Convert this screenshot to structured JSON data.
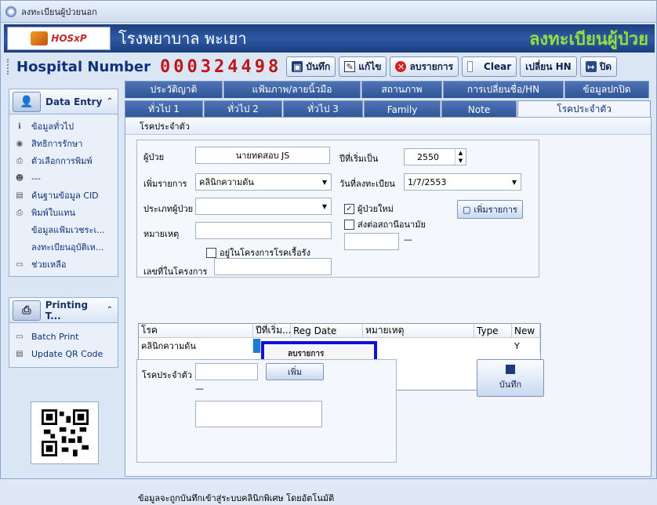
{
  "window": {
    "title": "ลงทะเบียนผู้ป่วยนอก"
  },
  "header": {
    "logo": "HOSxP",
    "hospital": "โรงพยาบาล พะเยา",
    "title": "ลงทะเบียนผู้ป่วย"
  },
  "toolbar": {
    "hn_label": "Hospital Number",
    "hn_value": "000324498",
    "save": "บันทึก",
    "edit": "แก้ไข",
    "delete": "ลบรายการ",
    "clear": "Clear",
    "change_hn": "เปลี่ยน HN",
    "close": "ปิด"
  },
  "sidebar": {
    "data_entry": {
      "title": "Data Entry",
      "items": [
        "ข้อมูลทั่วไป",
        "สิทธิการรักษา",
        "ตัวเลือกการพิมพ์",
        "---",
        "ค้นฐานข้อมูล CID",
        "พิมพ์ใบแทน",
        "ข้อมูลแฟ้มเวชระเ...",
        "ลงทะเบียนอุบัติเห...",
        "ช่วยเหลือ"
      ]
    },
    "printing": {
      "title": "Printing T...",
      "items": [
        "Batch Print",
        "Update QR Code"
      ]
    }
  },
  "tabs_row1": [
    "ประวัติญาติ",
    "แฟ้มภาพ/ลายนิ้วมือ",
    "สถานภาพ",
    "การเปลี่ยนชื่อ/HN",
    "ข้อมูลปกปิด"
  ],
  "tabs_row2": [
    "ทั่วไป 1",
    "ทั่วไป 2",
    "ทั่วไป 3",
    "Family",
    "Note",
    "โรคประจำตัว"
  ],
  "form": {
    "group_title": "โรคประจำตัว",
    "patient_label": "ผู้ป่วย",
    "patient_value": "นายทดสอบ  JS",
    "start_year_label": "ปีที่เริ่มเป็น",
    "start_year_value": "2550",
    "add_item_label": "เพิ่มรายการ",
    "add_item_value": "คลินิกความดัน",
    "reg_date_label": "วันที่ลงทะเบียน",
    "reg_date_value": "1/7/2553",
    "patient_type_label": "ประเภทผู้ป่วย",
    "new_patient_label": "ผู้ป่วยใหม่",
    "refer_label": "ส่งต่อสถานีอนามัย",
    "remark_label": "หมายเหตุ",
    "chronic_project_label": "อยู่ในโครงการโรคเรื้อรัง",
    "project_no_label": "เลขที่ในโครงการ",
    "add_button": "เพิ่มรายการ",
    "dash": "—"
  },
  "grid": {
    "headers": [
      "โรค",
      "ปีที่เริ่ม...",
      "Reg Date",
      "หมายเหตุ",
      "Type",
      "New"
    ],
    "rows": [
      {
        "disease": "คลินิกความดัน",
        "new": "Y"
      }
    ]
  },
  "context_menu": {
    "item": "ลบรายการ"
  },
  "chronic": {
    "label": "โรคประจำตัว",
    "add": "เพิ่ม",
    "dash": "—",
    "save": "บันทึก"
  },
  "footer_note": "ข้อมูลจะถูกบันทึกเข้าสู่ระบบคลินิกพิเศษ โดยอัตโนมัติ"
}
